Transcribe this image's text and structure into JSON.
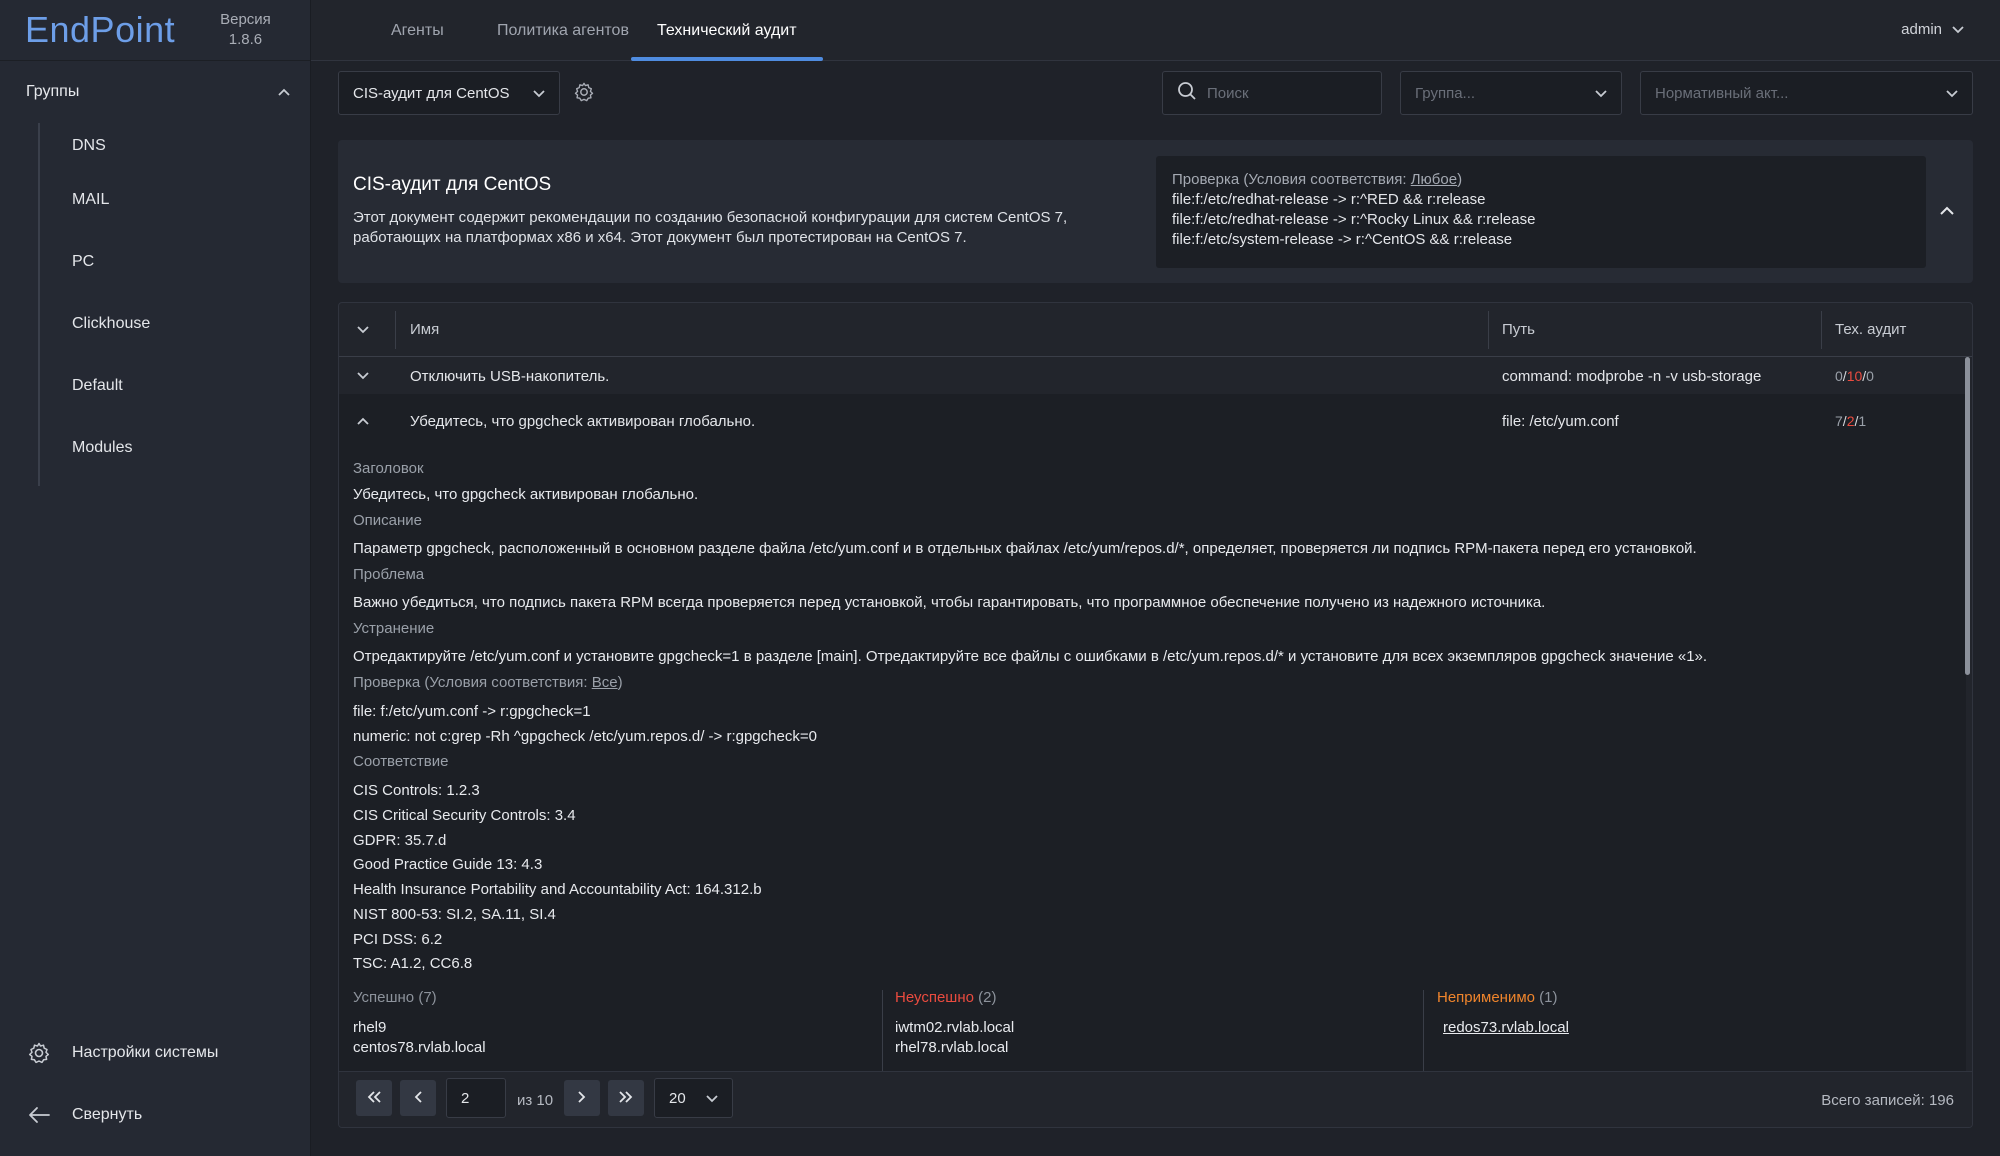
{
  "app": {
    "logo": "EndPoint",
    "version_label": "Версия",
    "version": "1.8.6"
  },
  "sidebar": {
    "groups_title": "Группы",
    "items": [
      "DNS",
      "MAIL",
      "PC",
      "Clickhouse",
      "Default",
      "Modules"
    ],
    "settings_label": "Настройки системы",
    "collapse_label": "Свернуть"
  },
  "tabs": [
    {
      "label": "Агенты",
      "active": false
    },
    {
      "label": "Политика агентов",
      "active": false
    },
    {
      "label": "Технический аудит",
      "active": true
    }
  ],
  "user": "admin",
  "toolbar": {
    "policy_value": "CIS-аудит для CentOS",
    "search_placeholder": "Поиск",
    "group_placeholder": "Группа...",
    "norm_placeholder": "Нормативный акт..."
  },
  "card": {
    "title": "CIS-аудит для CentOS",
    "desc_line1": "Этот документ содержит рекомендации по созданию безопасной конфигурации для систем CentOS 7,",
    "desc_line2": "работающих на платформах x86 и x64. Этот документ был протестирован на CentOS 7.",
    "check_label": "Проверка (Условия соответствия: ",
    "check_cond": "Любое",
    "check_close": ")",
    "check_lines": [
      "file:f:/etc/redhat-release -> r:^RED && r:release",
      "file:f:/etc/redhat-release -> r:^Rocky Linux && r:release",
      "file:f:/etc/system-release -> r:^CentOS && r:release"
    ]
  },
  "table": {
    "headers": {
      "name": "Имя",
      "path": "Путь",
      "audit": "Тех. аудит"
    },
    "rows": [
      {
        "name": "Отключить USB-накопитель.",
        "path": "command: modprobe -n -v usb-storage",
        "passed": "0",
        "failed": "10",
        "na": "0"
      },
      {
        "name": "Убедитесь, что gpgcheck активирован глобально.",
        "path": "file: /etc/yum.conf",
        "passed": "7",
        "failed": "2",
        "na": "1"
      }
    ]
  },
  "details": {
    "title_label": "Заголовок",
    "title": "Убедитесь, что gpgcheck активирован глобально.",
    "description_label": "Описание",
    "description": "Параметр gpgcheck, расположенный в основном разделе файла /etc/yum.conf и в отдельных файлах /etc/yum/repos.d/*, определяет, проверяется ли подпись RPM-пакета перед его установкой.",
    "problem_label": "Проблема",
    "problem": "Важно убедиться, что подпись пакета RPM всегда проверяется перед установкой, чтобы гарантировать, что программное обеспечение получено из надежного источника.",
    "fix_label": "Устранение",
    "fix": "Отредактируйте /etc/yum.conf и установите gpgcheck=1 в разделе [main]. Отредактируйте все файлы с ошибками в /etc/yum.repos.d/* и установите для всех экземпляров gpgcheck значение «1».",
    "check_label": "Проверка (Условия соответствия: ",
    "check_cond": "Все",
    "check_close": ")",
    "check_lines": [
      "file: f:/etc/yum.conf -> r:gpgcheck=1",
      "numeric: not c:grep -Rh ^gpgcheck /etc/yum.repos.d/ -> r:gpgcheck=0"
    ],
    "compliance_label": "Соответствие",
    "compliance": [
      "CIS Controls: 1.2.3",
      "CIS Critical Security Controls: 3.4",
      "GDPR: 35.7.d",
      "Good Practice Guide 13: 4.3",
      "Health Insurance Portability and Accountability Act: 164.312.b",
      "NIST 800-53: SI.2, SA.11, SI.4",
      "PCI DSS: 6.2",
      "TSC: A1.2, CC6.8"
    ],
    "results": {
      "success_label": "Успешно",
      "success_count": "(7)",
      "success_hosts": [
        "rhel9",
        "centos78.rvlab.local"
      ],
      "fail_label": "Неуспешно",
      "fail_count": "(2)",
      "fail_hosts": [
        "iwtm02.rvlab.local",
        "rhel78.rvlab.local"
      ],
      "na_label": "Неприменимо",
      "na_count": "(1)",
      "na_hosts": [
        "redos73.rvlab.local"
      ]
    }
  },
  "pagination": {
    "page": "2",
    "of_label": "из 10",
    "page_size": "20",
    "total": "Всего записей: 196"
  },
  "colors": {
    "accent": "#4f8ce0",
    "logo": "#6d9ee8",
    "fail": "#ea4b3f",
    "na": "#f0852c"
  }
}
